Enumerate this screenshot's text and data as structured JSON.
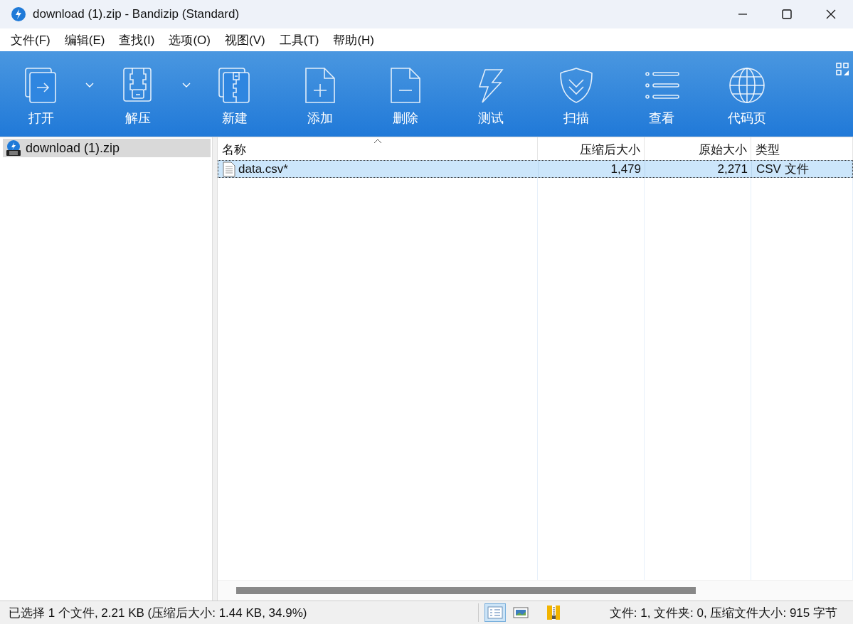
{
  "window": {
    "title": "download (1).zip - Bandizip (Standard)"
  },
  "menu": [
    "文件(F)",
    "编辑(E)",
    "查找(I)",
    "选项(O)",
    "视图(V)",
    "工具(T)",
    "帮助(H)"
  ],
  "toolbar": [
    {
      "label": "打开",
      "has_dropdown": true
    },
    {
      "label": "解压",
      "has_dropdown": true
    },
    {
      "label": "新建",
      "has_dropdown": false
    },
    {
      "label": "添加",
      "has_dropdown": false
    },
    {
      "label": "删除",
      "has_dropdown": false
    },
    {
      "label": "测试",
      "has_dropdown": false
    },
    {
      "label": "扫描",
      "has_dropdown": false
    },
    {
      "label": "查看",
      "has_dropdown": false
    },
    {
      "label": "代码页",
      "has_dropdown": false
    }
  ],
  "tree": {
    "items": [
      {
        "label": "download (1).zip",
        "selected": true
      }
    ]
  },
  "table": {
    "columns": [
      {
        "label": "名称",
        "sorted": true
      },
      {
        "label": "压缩后大小",
        "sorted": false
      },
      {
        "label": "原始大小",
        "sorted": false
      },
      {
        "label": "类型",
        "sorted": false
      }
    ],
    "rows": [
      {
        "cells": [
          "data.csv*",
          "1,479",
          "2,271",
          "CSV 文件"
        ],
        "selected": true
      }
    ]
  },
  "status_bar": {
    "selection": "已选择 1 个文件, 2.21 KB (压缩后大小: 1.44 KB, 34.9%)",
    "view_modes": [
      {
        "selected": true
      },
      {
        "selected": false
      }
    ],
    "summary": "文件: 1, 文件夹: 0, 压缩文件大小: 915 字节"
  }
}
